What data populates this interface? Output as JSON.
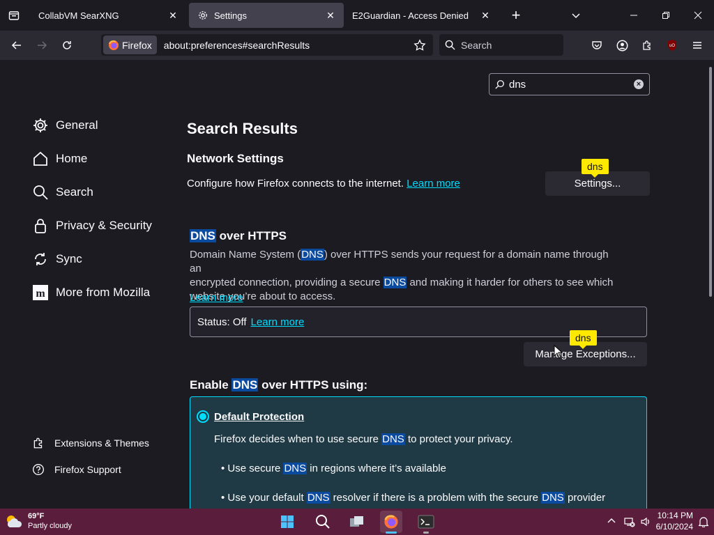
{
  "tabs": [
    {
      "title": "CollabVM SearXNG",
      "active": false
    },
    {
      "title": "Settings",
      "active": true
    },
    {
      "title": "E2Guardian - Access Denied",
      "active": false
    }
  ],
  "urlbar": {
    "identity": "Firefox",
    "url": "about:preferences#searchResults"
  },
  "searchbar": {
    "placeholder": "Search"
  },
  "find": {
    "value": "dns"
  },
  "sidebar": {
    "items": [
      {
        "label": "General",
        "icon": "gear-icon"
      },
      {
        "label": "Home",
        "icon": "home-icon"
      },
      {
        "label": "Search",
        "icon": "search-icon"
      },
      {
        "label": "Privacy & Security",
        "icon": "lock-icon"
      },
      {
        "label": "Sync",
        "icon": "sync-icon"
      },
      {
        "label": "More from Mozilla",
        "icon": "mozilla-icon"
      }
    ],
    "footer": [
      {
        "label": "Extensions & Themes",
        "icon": "puzzle-icon"
      },
      {
        "label": "Firefox Support",
        "icon": "help-icon"
      }
    ]
  },
  "main": {
    "title": "Search Results",
    "network": {
      "heading": "Network Settings",
      "description": "Configure how Firefox connects to the internet.",
      "learn_more": "Learn more",
      "button": "Settings...",
      "tooltip": "dns"
    },
    "doh": {
      "heading_hl": "DNS",
      "heading_rest": "over HTTPS",
      "desc_1": "Domain Name System (",
      "desc_hl1": "DNS",
      "desc_2": ") over HTTPS sends your request for a domain name through an",
      "desc_3": "encrypted connection, providing a secure ",
      "desc_hl2": "DNS",
      "desc_4": " and making it harder for others to see which",
      "desc_5": "website you’re about to access.",
      "learn_more": "Learn more",
      "status_label": "Status: Off",
      "status_learn_more": "Learn more",
      "exceptions_button": "Manage Exceptions...",
      "tooltip": "dns"
    },
    "enable": {
      "heading_1": "Enable ",
      "heading_hl": "DNS",
      "heading_2": " over HTTPS using:",
      "option_label": "Default Protection",
      "option_desc_1": "Firefox decides when to use secure ",
      "option_desc_hl": "DNS",
      "option_desc_2": " to protect your privacy.",
      "bullet1_1": "Use secure ",
      "bullet1_hl": "DNS",
      "bullet1_2": " in regions where it’s available",
      "bullet2_1": "Use your default ",
      "bullet2_hl1": "DNS",
      "bullet2_2": " resolver if there is a problem with the secure ",
      "bullet2_hl2": "DNS",
      "bullet2_3": " provider"
    }
  },
  "taskbar": {
    "temp": "69°F",
    "condition": "Partly cloudy",
    "time": "10:14 PM",
    "date": "6/10/2024"
  },
  "colors": {
    "accent": "#00ddff",
    "highlight": "#0a4a9f",
    "tooltip": "#ffe900",
    "taskbar": "#5a1e3c"
  }
}
